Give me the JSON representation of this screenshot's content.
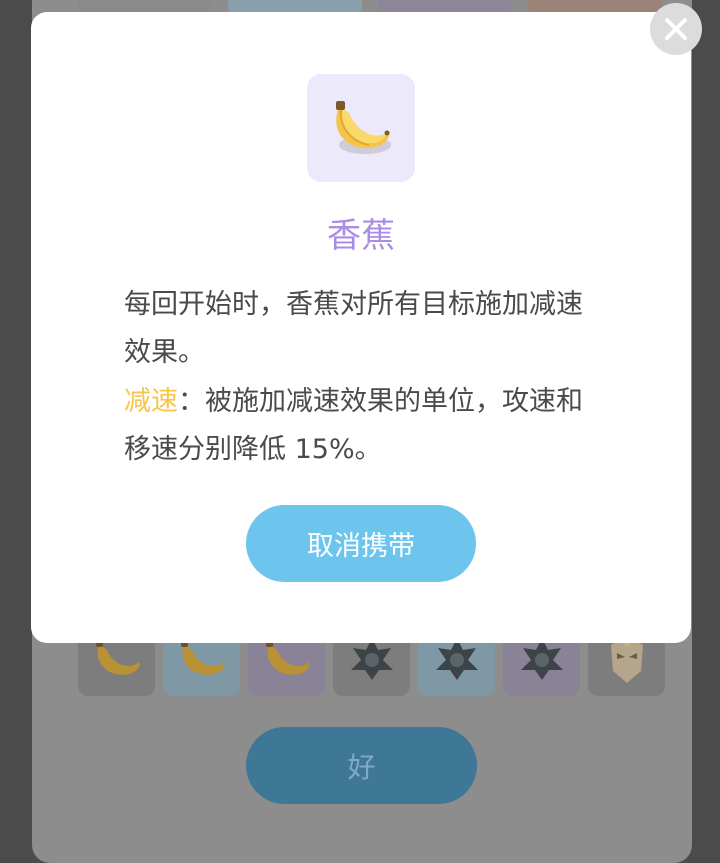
{
  "modal": {
    "title": "香蕉",
    "description": "每回开始时，香蕉对所有目标施加减速效果。",
    "keyword": "减速",
    "keyword_desc": "：被施加减速效果的单位，攻速和移速分别降低 15%。",
    "cancel_label": "取消携带",
    "icon": "banana-icon",
    "close_icon": "close-icon"
  },
  "background": {
    "ok_label": "好",
    "items": [
      {
        "icon": "banana-icon",
        "slot": "grey"
      },
      {
        "icon": "banana-icon",
        "slot": "blue"
      },
      {
        "icon": "banana-icon",
        "slot": "purple"
      },
      {
        "icon": "ninja-icon",
        "slot": "grey"
      },
      {
        "icon": "ninja-icon",
        "slot": "blue"
      },
      {
        "icon": "ninja-icon",
        "slot": "purple"
      },
      {
        "icon": "mask-icon",
        "slot": "grey"
      }
    ]
  },
  "colors": {
    "title": "#a98ce4",
    "keyword": "#f5c64a",
    "cancel_button": "#6dc5ee",
    "ok_button": "#3e7896"
  }
}
